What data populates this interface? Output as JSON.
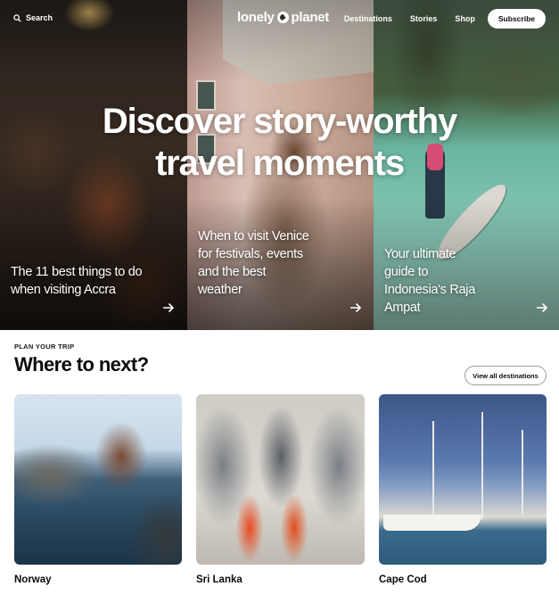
{
  "nav": {
    "search_label": "Search",
    "logo_text": "lonely planet",
    "links": [
      "Destinations",
      "Stories",
      "Shop"
    ],
    "subscribe_label": "Subscribe"
  },
  "hero": {
    "headline_line1": "Discover story-worthy",
    "headline_line2": "travel moments",
    "cards": [
      {
        "caption": "The 11 best things to do when visiting Accra"
      },
      {
        "caption": "When to visit Venice for festivals, events and the best weather"
      },
      {
        "caption": "Your ultimate guide to Indonesia's Raja Ampat"
      }
    ]
  },
  "plan": {
    "eyebrow": "PLAN YOUR TRIP",
    "title": "Where to next?",
    "view_all_label": "View all destinations",
    "destinations": [
      {
        "name": "Norway"
      },
      {
        "name": "Sri Lanka"
      },
      {
        "name": "Cape Cod"
      }
    ]
  },
  "icons": {
    "search": "search-icon",
    "arrow": "arrow-right-icon",
    "logo": "globe-logo-icon"
  }
}
